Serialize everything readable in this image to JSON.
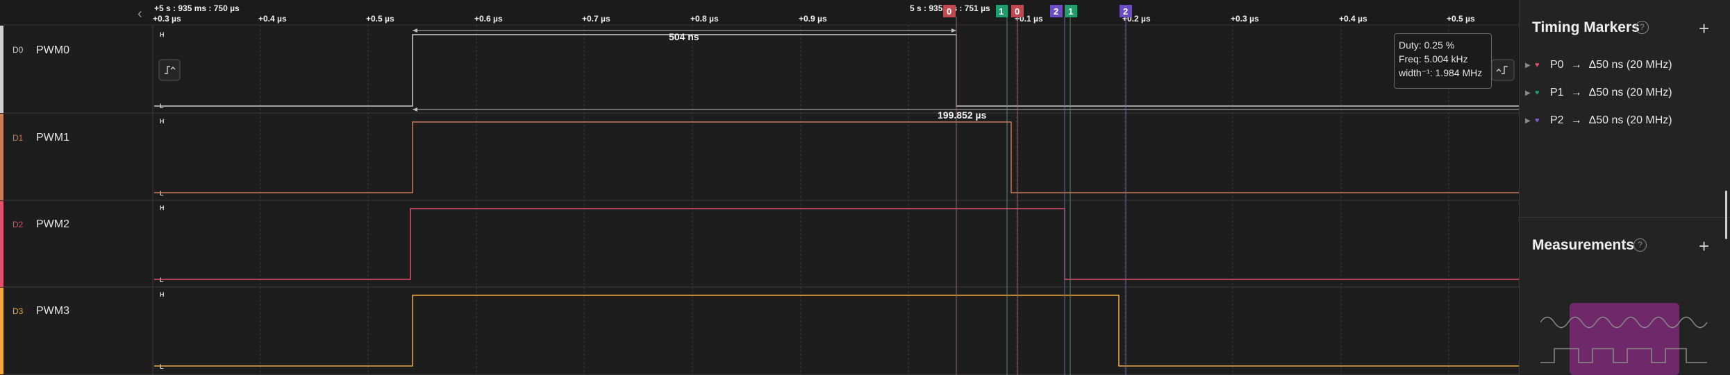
{
  "timeline": {
    "left_timestamp": "+5 s : 935 ms : 750 µs",
    "mid_timestamp": "5 s : 935 ms : 751 µs",
    "ticks_a": [
      "+0.3 µs",
      "+0.4 µs",
      "+0.5 µs",
      "+0.6 µs",
      "+0.7 µs",
      "+0.8 µs",
      "+0.9 µs"
    ],
    "ticks_b": [
      "+0.1 µs",
      "+0.2 µs",
      "+0.3 µs",
      "+0.4 µs",
      "+0.5 µs"
    ]
  },
  "channels": [
    {
      "index": "D0",
      "name": "PWM0",
      "color": "#cfcfcf",
      "high_label": "H",
      "low_label": "L"
    },
    {
      "index": "D1",
      "name": "PWM1",
      "color": "#c97b5a",
      "high_label": "H",
      "low_label": "L"
    },
    {
      "index": "D2",
      "name": "PWM2",
      "color": "#e0516b",
      "high_label": "H",
      "low_label": "L"
    },
    {
      "index": "D3",
      "name": "PWM3",
      "color": "#f2a93b",
      "high_label": "H",
      "low_label": "L"
    }
  ],
  "measurements_on_trace": {
    "pulse_width": "504 ns",
    "period": "199.852 µs"
  },
  "markers": {
    "flags": [
      "0",
      "1",
      "0",
      "2",
      "1",
      "2"
    ],
    "colors": {
      "p0": "#c0494f",
      "p1": "#1f9e6d",
      "p2": "#6a4cc4"
    }
  },
  "tooltip": {
    "duty": "Duty: 0.25 %",
    "freq": "Freq: 5.004 kHz",
    "width": "width⁻¹: 1.984 MHz"
  },
  "side_panel": {
    "timing_markers_title": "Timing Markers",
    "measurements_title": "Measurements",
    "help_glyph": "?",
    "add_glyph": "+",
    "timing_markers": [
      {
        "name": "P0",
        "arrow": "→",
        "value": "Δ50 ns (20 MHz)",
        "color": "#e0516b"
      },
      {
        "name": "P1",
        "arrow": "→",
        "value": "Δ50 ns (20 MHz)",
        "color": "#1f9e6d"
      },
      {
        "name": "P2",
        "arrow": "→",
        "value": "Δ50 ns (20 MHz)",
        "color": "#7b5bd6"
      }
    ]
  }
}
